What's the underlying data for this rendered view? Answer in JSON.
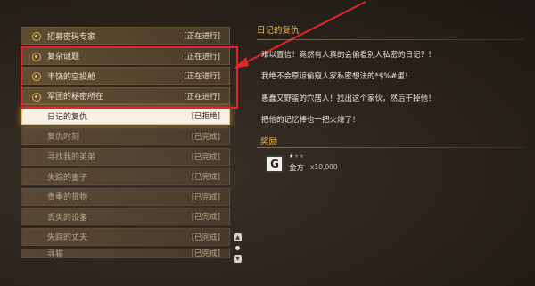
{
  "quests": [
    {
      "name": "招募密码专家",
      "status": "[正在进行]",
      "state": "in-progress"
    },
    {
      "name": "复杂谜题",
      "status": "[正在进行]",
      "state": "in-progress"
    },
    {
      "name": "丰饶的空投舱",
      "status": "[正在进行]",
      "state": "in-progress"
    },
    {
      "name": "军团的秘密所在",
      "status": "[正在进行]",
      "state": "in-progress"
    },
    {
      "name": "日记的复仇",
      "status": "[已拒绝]",
      "state": "selected"
    },
    {
      "name": "复仇时刻",
      "status": "[已完成]",
      "state": "done"
    },
    {
      "name": "寻找我的弟弟",
      "status": "[已完成]",
      "state": "done"
    },
    {
      "name": "失踪的妻子",
      "status": "[已完成]",
      "state": "done"
    },
    {
      "name": "贵重的货物",
      "status": "[已完成]",
      "state": "done"
    },
    {
      "name": "丢失的设备",
      "status": "[已完成]",
      "state": "done"
    },
    {
      "name": "失踪的丈夫",
      "status": "[已完成]",
      "state": "done"
    },
    {
      "name": "寻猫",
      "status": "[已完成]",
      "state": "done"
    }
  ],
  "detail": {
    "title": "日记的复仇",
    "lines": [
      "难以置信！竟然有人真的会偷看别人私密的日记？！",
      "我绝不会原谅偷窥人家私密想法的*$%#蛋！",
      "愚蠢又野蛮的穴居人！找出这个家伙，然后干掉他！",
      "把他的记忆棒也一把火烧了！"
    ]
  },
  "reward": {
    "title": "奖励",
    "icon_letter": "G",
    "stars_filled": "★",
    "stars_empty": "★★",
    "name": "金方",
    "quantity": "x10,000"
  },
  "colors": {
    "accent": "#f0b54a",
    "highlight_box": "#e2262b",
    "selected_bg": "#f7f1e4"
  }
}
